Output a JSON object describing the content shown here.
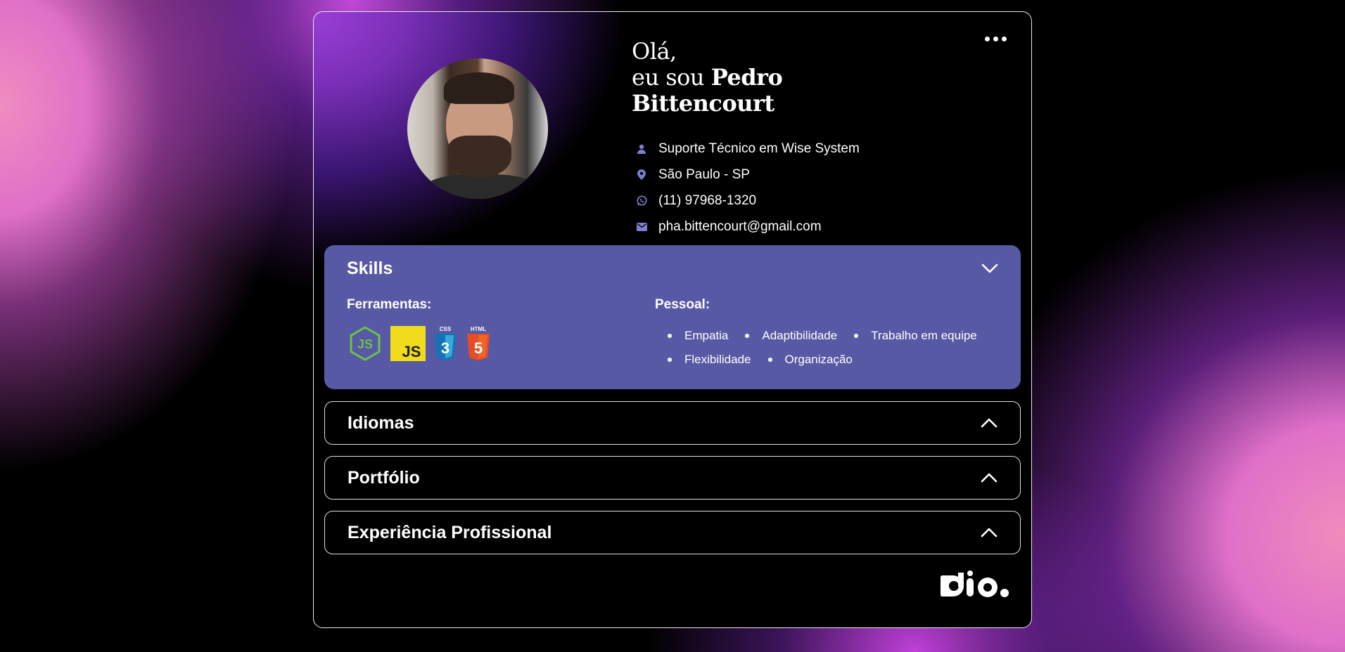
{
  "profile": {
    "greeting": "Olá,",
    "intro_prefix": "eu sou",
    "first_name": "Pedro",
    "last_name": "Bittencourt",
    "job": "Suporte Técnico em Wise System",
    "location": "São Paulo - SP",
    "phone": "(11) 97968-1320",
    "email": "pha.bittencourt@gmail.com"
  },
  "skills": {
    "title": "Skills",
    "tools_label": "Ferramentas:",
    "tools": [
      "nodejs-icon",
      "javascript-icon",
      "css3-icon",
      "html5-icon"
    ],
    "tool_labels": {
      "css": "CSS",
      "html": "HTML",
      "js": "JS"
    },
    "personal_label": "Pessoal:",
    "personal": [
      "Empatia",
      "Adaptibilidade",
      "Trabalho em equipe",
      "Flexibilidade",
      "Organização"
    ]
  },
  "sections": {
    "languages": "Idiomas",
    "portfolio": "Portfólio",
    "experience": "Experiência Profissional"
  },
  "colors": {
    "accent": "#5759a4",
    "icon": "#7b7fd0"
  }
}
